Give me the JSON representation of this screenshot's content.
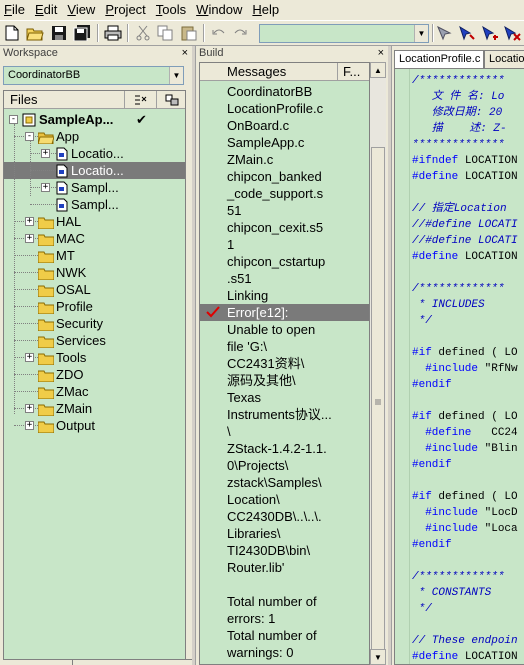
{
  "menu": {
    "items": [
      {
        "label": "File",
        "u": "F",
        "rest": "ile"
      },
      {
        "label": "Edit",
        "u": "E",
        "rest": "dit"
      },
      {
        "label": "View",
        "u": "V",
        "rest": "iew"
      },
      {
        "label": "Project",
        "u": "P",
        "rest": "roject"
      },
      {
        "label": "Tools",
        "u": "T",
        "rest": "ools"
      },
      {
        "label": "Window",
        "u": "W",
        "rest": "indow"
      },
      {
        "label": "Help",
        "u": "H",
        "rest": "elp"
      }
    ]
  },
  "toolbar": {
    "combo_value": ""
  },
  "workspace": {
    "title": "Workspace",
    "close": "×",
    "config": "CoordinatorBB",
    "files_header": "Files",
    "tree": [
      {
        "label": "SampleAp...",
        "depth": 0,
        "type": "project",
        "exp": "−",
        "check": "✔",
        "bold": true
      },
      {
        "label": "App",
        "depth": 1,
        "type": "folder",
        "exp": "−"
      },
      {
        "label": "Locatio...",
        "depth": 2,
        "type": "file",
        "exp": "+"
      },
      {
        "label": "Locatio...",
        "depth": 2,
        "type": "file",
        "exp": "",
        "selected": true
      },
      {
        "label": "Sampl...",
        "depth": 2,
        "type": "file",
        "exp": "+"
      },
      {
        "label": "Sampl...",
        "depth": 2,
        "type": "file",
        "exp": ""
      },
      {
        "label": "HAL",
        "depth": 1,
        "type": "folder",
        "exp": "+"
      },
      {
        "label": "MAC",
        "depth": 1,
        "type": "folder",
        "exp": "+"
      },
      {
        "label": "MT",
        "depth": 1,
        "type": "folder",
        "exp": ""
      },
      {
        "label": "NWK",
        "depth": 1,
        "type": "folder",
        "exp": ""
      },
      {
        "label": "OSAL",
        "depth": 1,
        "type": "folder",
        "exp": ""
      },
      {
        "label": "Profile",
        "depth": 1,
        "type": "folder",
        "exp": ""
      },
      {
        "label": "Security",
        "depth": 1,
        "type": "folder",
        "exp": ""
      },
      {
        "label": "Services",
        "depth": 1,
        "type": "folder",
        "exp": ""
      },
      {
        "label": "Tools",
        "depth": 1,
        "type": "folder",
        "exp": "+"
      },
      {
        "label": "ZDO",
        "depth": 1,
        "type": "folder",
        "exp": ""
      },
      {
        "label": "ZMac",
        "depth": 1,
        "type": "folder",
        "exp": ""
      },
      {
        "label": "ZMain",
        "depth": 1,
        "type": "folder",
        "exp": "+"
      },
      {
        "label": "Output",
        "depth": 1,
        "type": "folder",
        "exp": "+"
      }
    ]
  },
  "build": {
    "title": "Build",
    "close": "×",
    "col_messages": "Messages",
    "col_file": "F...",
    "lines": [
      "CoordinatorBB",
      "LocationProfile.c",
      "OnBoard.c",
      "SampleApp.c",
      "ZMain.c",
      "chipcon_banked",
      "_code_support.s",
      "51",
      "chipcon_cexit.s5",
      "1",
      "chipcon_cstartup",
      ".s51",
      "Linking",
      "Error[e12]:",
      "Unable to open",
      "file 'G:\\",
      "CC2431资料\\",
      "源码及其他\\",
      "Texas",
      "Instruments协议...",
      "\\",
      "ZStack-1.4.2-1.1.",
      "0\\Projects\\",
      "zstack\\Samples\\",
      "Location\\",
      "CC2430DB\\..\\..\\.",
      "Libraries\\",
      "TI2430DB\\bin\\",
      "Router.lib'",
      "",
      "Total number of",
      "errors: 1",
      "Total number of",
      "warnings: 0"
    ],
    "error_index": 13
  },
  "editor": {
    "tab_active": "LocationProfile.c",
    "tab_inactive": "Location",
    "lines": [
      {
        "t": "/*************",
        "c": "comment"
      },
      {
        "t": "   文 件 名: Lo",
        "c": "comment"
      },
      {
        "t": "   修改日期: 20",
        "c": "comment"
      },
      {
        "t": "   描    述: Z-",
        "c": "comment"
      },
      {
        "t": "**************",
        "c": "comment"
      },
      {
        "t": "#ifndef LOCATION",
        "c": "mixed_ifndef"
      },
      {
        "t": "#define LOCATION",
        "c": "mixed_define"
      },
      {
        "t": "",
        "c": "black"
      },
      {
        "t": "// 指定Location",
        "c": "comment"
      },
      {
        "t": "//#define LOCATI",
        "c": "comment"
      },
      {
        "t": "//#define LOCATI",
        "c": "comment"
      },
      {
        "t": "#define LOCATION",
        "c": "mixed_define"
      },
      {
        "t": "",
        "c": "black"
      },
      {
        "t": "/*************",
        "c": "comment"
      },
      {
        "t": " * INCLUDES",
        "c": "comment"
      },
      {
        "t": " */",
        "c": "comment"
      },
      {
        "t": "",
        "c": "black"
      },
      {
        "t": "#if defined ( LO",
        "c": "mixed_if"
      },
      {
        "t": "  #include \"RfNw",
        "c": "mixed_include"
      },
      {
        "t": "#endif",
        "c": "blue"
      },
      {
        "t": "",
        "c": "black"
      },
      {
        "t": "#if defined ( LO",
        "c": "mixed_if"
      },
      {
        "t": "  #define   CC24",
        "c": "mixed_define2"
      },
      {
        "t": "  #include \"Blin",
        "c": "mixed_include"
      },
      {
        "t": "#endif",
        "c": "blue"
      },
      {
        "t": "",
        "c": "black"
      },
      {
        "t": "#if defined ( LO",
        "c": "mixed_if"
      },
      {
        "t": "  #include \"LocD",
        "c": "mixed_include"
      },
      {
        "t": "  #include \"Loca",
        "c": "mixed_include"
      },
      {
        "t": "#endif",
        "c": "blue"
      },
      {
        "t": "",
        "c": "black"
      },
      {
        "t": "/*************",
        "c": "comment"
      },
      {
        "t": " * CONSTANTS",
        "c": "comment"
      },
      {
        "t": " */",
        "c": "comment"
      },
      {
        "t": "",
        "c": "black"
      },
      {
        "t": "// These endpoin",
        "c": "comment"
      },
      {
        "t": "#define LOCATION",
        "c": "mixed_define"
      }
    ]
  }
}
